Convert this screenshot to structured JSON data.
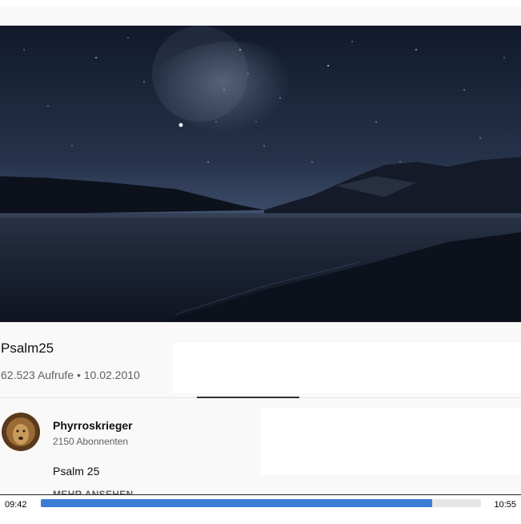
{
  "video": {
    "title": "Psalm25",
    "views_date": "62.523 Aufrufe • 10.02.2010"
  },
  "channel": {
    "name": "Phyrroskrieger",
    "subscribers": "2150 Abonnenten"
  },
  "description": {
    "text": "Psalm 25",
    "more_label": "MEHR ANSEHEN"
  },
  "player": {
    "current_time": "09:42",
    "total_time": "10:55",
    "progress": 0.889
  },
  "colors": {
    "progress_fill": "#3c7dd4",
    "progress_track": "#e6e6e6"
  }
}
